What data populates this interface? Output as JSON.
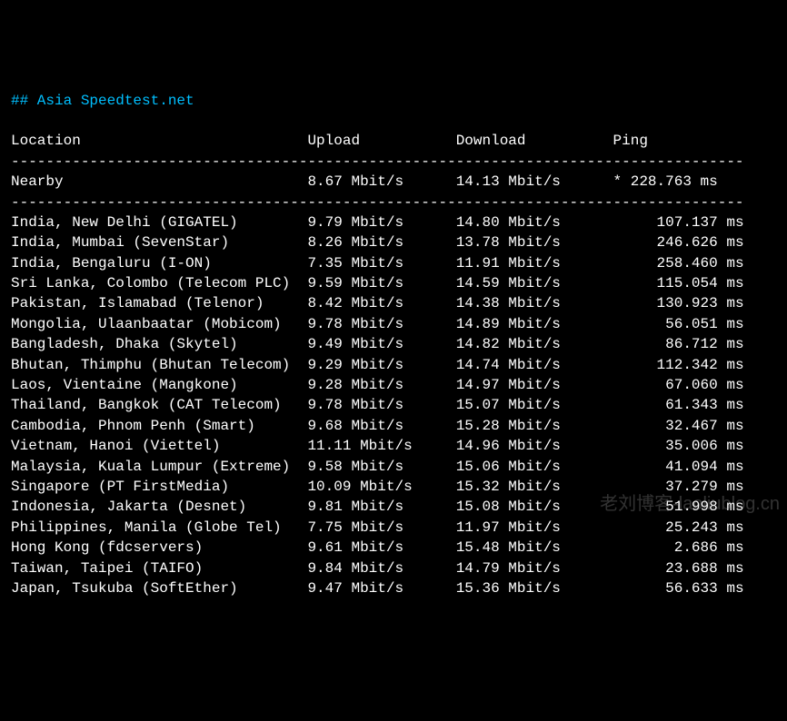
{
  "title": "## Asia Speedtest.net",
  "columns": {
    "location": "Location",
    "upload": "Upload",
    "download": "Download",
    "ping": "Ping"
  },
  "nearby": {
    "label": "Nearby",
    "upload": "8.67 Mbit/s",
    "download": "14.13 Mbit/s",
    "ping": "* 228.763 ms"
  },
  "rows": [
    {
      "location": "India, New Delhi (GIGATEL)",
      "upload": "9.79 Mbit/s",
      "download": "14.80 Mbit/s",
      "ping": "107.137 ms"
    },
    {
      "location": "India, Mumbai (SevenStar)",
      "upload": "8.26 Mbit/s",
      "download": "13.78 Mbit/s",
      "ping": "246.626 ms"
    },
    {
      "location": "India, Bengaluru (I-ON)",
      "upload": "7.35 Mbit/s",
      "download": "11.91 Mbit/s",
      "ping": "258.460 ms"
    },
    {
      "location": "Sri Lanka, Colombo (Telecom PLC)",
      "upload": "9.59 Mbit/s",
      "download": "14.59 Mbit/s",
      "ping": "115.054 ms"
    },
    {
      "location": "Pakistan, Islamabad (Telenor)",
      "upload": "8.42 Mbit/s",
      "download": "14.38 Mbit/s",
      "ping": "130.923 ms"
    },
    {
      "location": "Mongolia, Ulaanbaatar (Mobicom)",
      "upload": "9.78 Mbit/s",
      "download": "14.89 Mbit/s",
      "ping": "56.051 ms"
    },
    {
      "location": "Bangladesh, Dhaka (Skytel)",
      "upload": "9.49 Mbit/s",
      "download": "14.82 Mbit/s",
      "ping": "86.712 ms"
    },
    {
      "location": "Bhutan, Thimphu (Bhutan Telecom)",
      "upload": "9.29 Mbit/s",
      "download": "14.74 Mbit/s",
      "ping": "112.342 ms"
    },
    {
      "location": "Laos, Vientaine (Mangkone)",
      "upload": "9.28 Mbit/s",
      "download": "14.97 Mbit/s",
      "ping": "67.060 ms"
    },
    {
      "location": "Thailand, Bangkok (CAT Telecom)",
      "upload": "9.78 Mbit/s",
      "download": "15.07 Mbit/s",
      "ping": "61.343 ms"
    },
    {
      "location": "Cambodia, Phnom Penh (Smart)",
      "upload": "9.68 Mbit/s",
      "download": "15.28 Mbit/s",
      "ping": "32.467 ms"
    },
    {
      "location": "Vietnam, Hanoi (Viettel)",
      "upload": "11.11 Mbit/s",
      "download": "14.96 Mbit/s",
      "ping": "35.006 ms"
    },
    {
      "location": "Malaysia, Kuala Lumpur (Extreme)",
      "upload": "9.58 Mbit/s",
      "download": "15.06 Mbit/s",
      "ping": "41.094 ms"
    },
    {
      "location": "Singapore (PT FirstMedia)",
      "upload": "10.09 Mbit/s",
      "download": "15.32 Mbit/s",
      "ping": "37.279 ms"
    },
    {
      "location": "Indonesia, Jakarta (Desnet)",
      "upload": "9.81 Mbit/s",
      "download": "15.08 Mbit/s",
      "ping": "51.998 ms"
    },
    {
      "location": "Philippines, Manila (Globe Tel)",
      "upload": "7.75 Mbit/s",
      "download": "11.97 Mbit/s",
      "ping": "25.243 ms"
    },
    {
      "location": "Hong Kong (fdcservers)",
      "upload": "9.61 Mbit/s",
      "download": "15.48 Mbit/s",
      "ping": "2.686 ms"
    },
    {
      "location": "Taiwan, Taipei (TAIFO)",
      "upload": "9.84 Mbit/s",
      "download": "14.79 Mbit/s",
      "ping": "23.688 ms"
    },
    {
      "location": "Japan, Tsukuba (SoftEther)",
      "upload": "9.47 Mbit/s",
      "download": "15.36 Mbit/s",
      "ping": "56.633 ms"
    }
  ],
  "watermark": "老刘博客-laoliublog.cn"
}
